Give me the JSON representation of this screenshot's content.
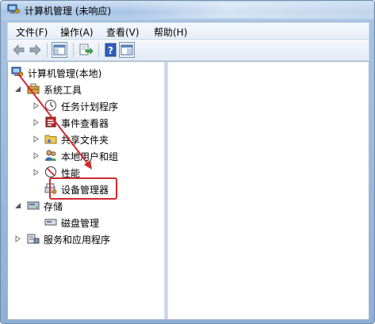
{
  "window": {
    "title": "计算机管理 (未响应)"
  },
  "menu": {
    "items": [
      {
        "label": "文件(F)"
      },
      {
        "label": "操作(A)"
      },
      {
        "label": "查看(V)"
      },
      {
        "label": "帮助(H)"
      }
    ]
  },
  "toolbar": {
    "buttons": [
      "back-arrow-icon",
      "forward-arrow-icon",
      "show-tree-icon",
      "export-list-icon",
      "help-icon",
      "properties-icon"
    ]
  },
  "tree": {
    "root": "计算机管理(本地)",
    "system_tools": "系统工具",
    "task_scheduler": "任务计划程序",
    "event_viewer": "事件查看器",
    "shared_folders": "共享文件夹",
    "local_users": "本地用户和组",
    "performance": "性能",
    "device_manager": "设备管理器",
    "storage": "存储",
    "disk_management": "磁盘管理",
    "services_apps": "服务和应用程序"
  },
  "annotation": {
    "arrow_color": "#d1292f",
    "highlight_color": "#d1292f"
  }
}
